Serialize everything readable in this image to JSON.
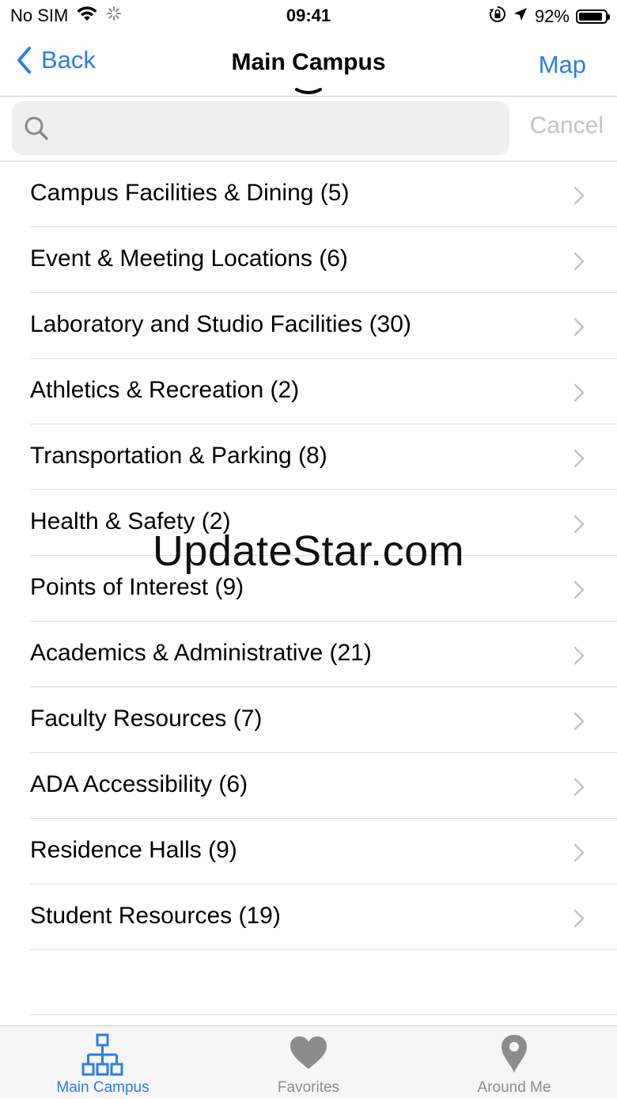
{
  "status_bar": {
    "carrier": "No SIM",
    "time": "09:41",
    "battery": "92%",
    "battery_fraction": 0.92
  },
  "nav": {
    "back_label": "Back",
    "title": "Main Campus",
    "right_label": "Map"
  },
  "search": {
    "placeholder": "",
    "value": "",
    "cancel_label": "Cancel"
  },
  "categories": [
    {
      "label": "Campus Facilities & Dining (5)"
    },
    {
      "label": "Event & Meeting Locations (6)"
    },
    {
      "label": "Laboratory and Studio Facilities (30)"
    },
    {
      "label": "Athletics & Recreation (2)"
    },
    {
      "label": "Transportation & Parking (8)"
    },
    {
      "label": "Health & Safety (2)"
    },
    {
      "label": "Points of Interest (9)"
    },
    {
      "label": "Academics & Administrative (21)"
    },
    {
      "label": "Faculty Resources (7)"
    },
    {
      "label": "ADA Accessibility (6)"
    },
    {
      "label": "Residence Halls (9)"
    },
    {
      "label": "Student Resources (19)"
    }
  ],
  "watermark": "UpdateStar.com",
  "tabbar": {
    "tabs": [
      {
        "label": "Main Campus",
        "icon": "sitemap-icon",
        "active": true
      },
      {
        "label": "Favorites",
        "icon": "heart-icon",
        "active": false
      },
      {
        "label": "Around Me",
        "icon": "map-pin-icon",
        "active": false
      }
    ]
  },
  "colors": {
    "accent": "#2f7ce6",
    "inactive": "#8c8c8c",
    "separator": "#dcdce0"
  }
}
